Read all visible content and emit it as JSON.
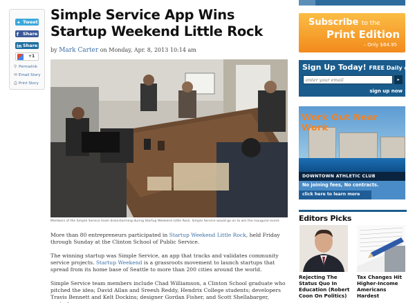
{
  "share": {
    "tweet": "Tweet",
    "share_fb": "Share",
    "share_li": "Share",
    "plus_one": "+1",
    "permalink": "Permalink",
    "email_story": "Email Story",
    "print_story": "Print Story"
  },
  "article": {
    "headline": "Simple Service App Wins Startup Weekend Little Rock",
    "by": "by",
    "author": "Mark Carter",
    "date": "on Monday, Apr. 8, 2013 10:14 am",
    "caption": "Members of the Simple Service team brainstorming during Startup Weekend Little Rock. Simple Service would go on to win the inaugural event.",
    "p1_a": "More than 80 entrepreneurs participated in ",
    "p1_link": "Startup Weekend Little Rock",
    "p1_b": ", held Friday through Sunday at the Clinton School of Public Service.",
    "p2_a": "The winning startup was Simple Service, an app that tracks and validates community service projects. ",
    "p2_link": "Startup Weekend",
    "p2_b": " is a grassroots movement to launch startups that spread from its home base of Seattle to more than 200 cities around the world.",
    "p3": "Simple Service team members include Chad Williamson, a Clinton School graduate who pitched the idea; David Allan and Sreesh Reddy, Hendrix College students; developers Travis Bennett and Kelt Dockins; designer Gordan Fisher, and Scott Shellabarger, project manager."
  },
  "ads": {
    "subscribe_line1": "Subscribe",
    "subscribe_to_the": "to the",
    "subscribe_line2": "Print Edition",
    "subscribe_price": "– Only $64.95",
    "signup_title": "Sign Up Today!",
    "signup_sub": "FREE Daily eNews",
    "email_placeholder": "enter your email",
    "signup_now": "sign up now",
    "work_out": "Work Out",
    "near_work": "Near Work",
    "club_name": "DOWNTOWN ATHLETIC CLUB",
    "no_fees": "No joining fees, No contracts.",
    "learn_more": "click here to learn more"
  },
  "editors_picks": {
    "title": "Editors Picks",
    "items": [
      {
        "caption": "Rejecting The Status Quo In Education (Robert Coon On Politics)"
      },
      {
        "caption": "Tax Changes Hit Higher-Income Americans Hardest"
      }
    ]
  }
}
